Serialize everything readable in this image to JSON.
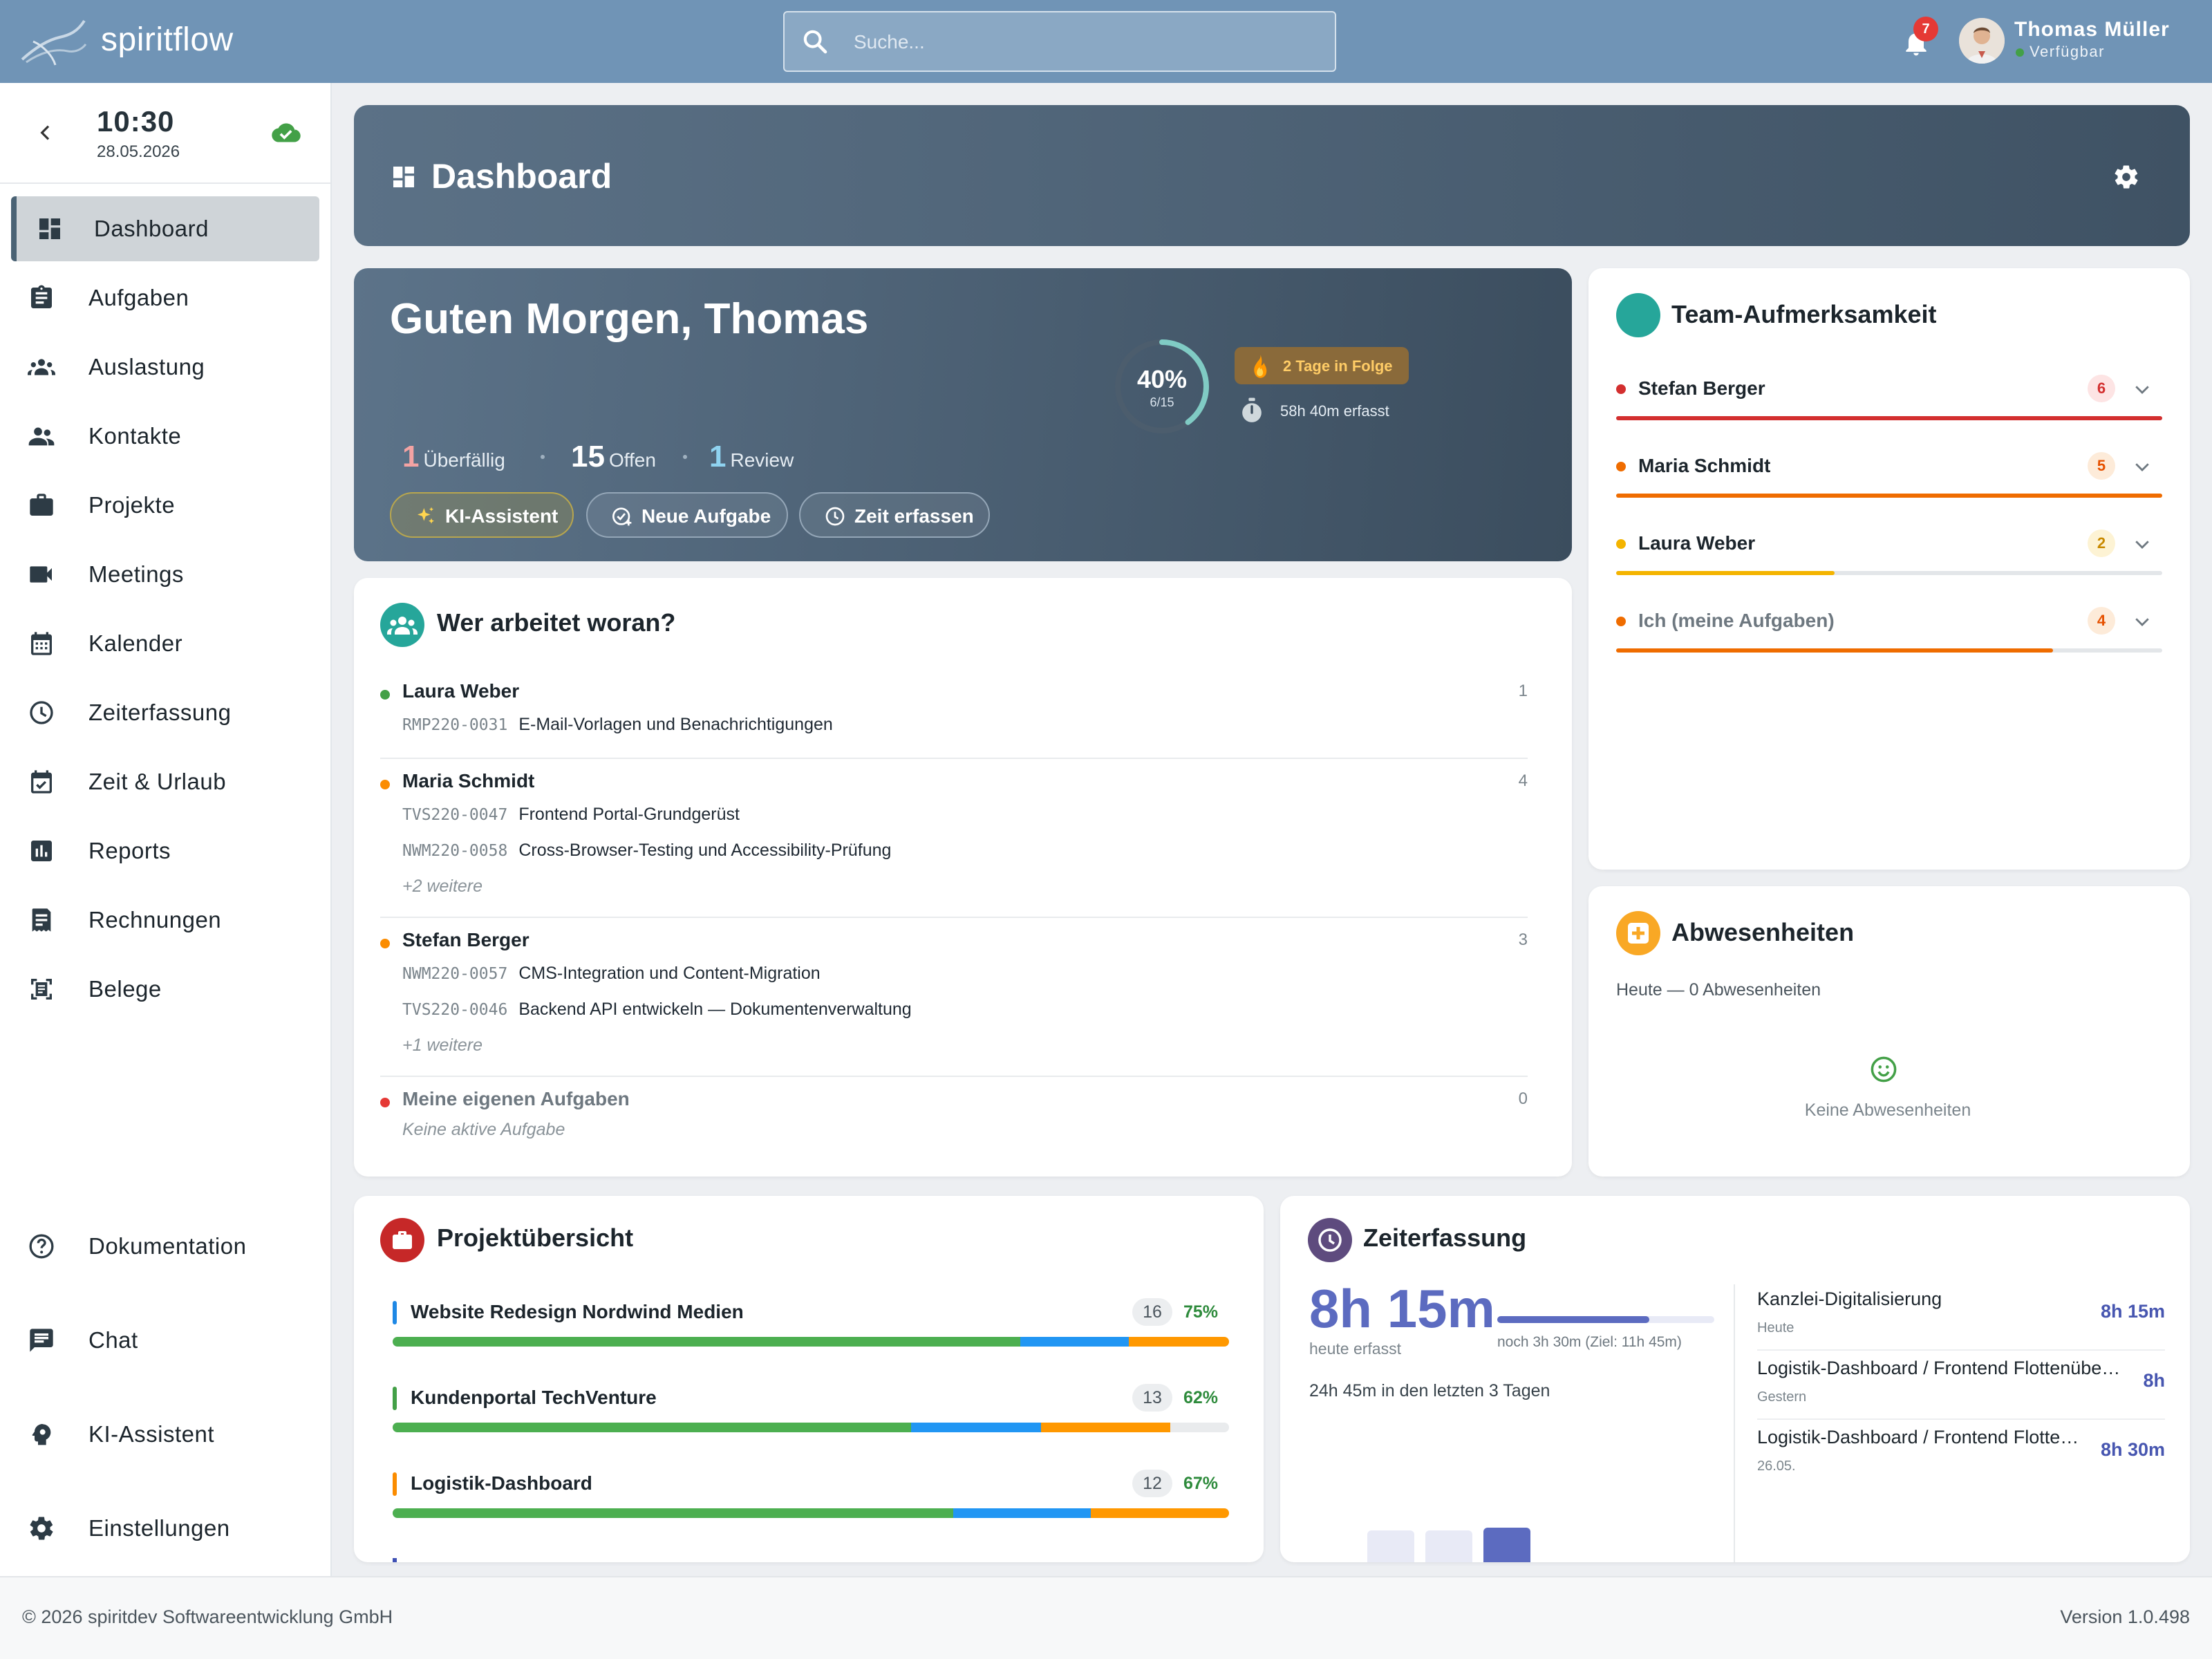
{
  "app": {
    "brand": "spiritflow",
    "search_placeholder": "Suche...",
    "notification_count": "7",
    "user": {
      "name": "Thomas Müller",
      "status": "Verfügbar"
    }
  },
  "sidebar": {
    "time": "10:30",
    "date": "28.05.2026",
    "items": [
      {
        "label": "Dashboard",
        "icon": "dashboard-icon",
        "active": true
      },
      {
        "label": "Aufgaben",
        "icon": "clipboard-icon"
      },
      {
        "label": "Auslastung",
        "icon": "group-icon"
      },
      {
        "label": "Kontakte",
        "icon": "people-icon"
      },
      {
        "label": "Projekte",
        "icon": "briefcase-icon"
      },
      {
        "label": "Meetings",
        "icon": "video-icon"
      },
      {
        "label": "Kalender",
        "icon": "calendar-icon"
      },
      {
        "label": "Zeiterfassung",
        "icon": "clock-icon"
      },
      {
        "label": "Zeit & Urlaub",
        "icon": "calendar-check-icon"
      },
      {
        "label": "Reports",
        "icon": "bar-chart-icon"
      },
      {
        "label": "Rechnungen",
        "icon": "invoice-icon"
      },
      {
        "label": "Belege",
        "icon": "receipt-icon"
      }
    ],
    "bottom_items": [
      {
        "label": "Dokumentation",
        "icon": "help-icon"
      },
      {
        "label": "Chat",
        "icon": "chat-icon"
      },
      {
        "label": "KI-Assistent",
        "icon": "ai-head-icon"
      },
      {
        "label": "Einstellungen",
        "icon": "settings-icon"
      }
    ]
  },
  "dashboard": {
    "title": "Dashboard"
  },
  "greeting": {
    "title": "Guten Morgen, Thomas",
    "progress_pct": "40%",
    "progress_fraction": "6/15",
    "progress_value": 0.4,
    "streak": "2 Tage in Folge",
    "tracked": "58h 40m erfasst",
    "stats": [
      {
        "value": "1",
        "label": "Überfällig",
        "color": "#f4a3a3"
      },
      {
        "value": "15",
        "label": "Offen",
        "color": "#ffffff"
      },
      {
        "value": "1",
        "label": "Review",
        "color": "#8fd3f0"
      }
    ],
    "buttons": {
      "ai": "KI-Assistent",
      "new_task": "Neue Aufgabe",
      "track_time": "Zeit erfassen"
    }
  },
  "who_works": {
    "title": "Wer arbeitet woran?",
    "people": [
      {
        "name": "Laura Weber",
        "count": "1",
        "color": "#43a047",
        "tasks": [
          {
            "code": "RMP220-0031",
            "title": "E-Mail-Vorlagen und Benachrichtigungen"
          }
        ],
        "more": ""
      },
      {
        "name": "Maria Schmidt",
        "count": "4",
        "color": "#fb8c00",
        "tasks": [
          {
            "code": "TVS220-0047",
            "title": "Frontend Portal-Grundgerüst"
          },
          {
            "code": "NWM220-0058",
            "title": "Cross-Browser-Testing und Accessibility-Prüfung"
          }
        ],
        "more": "+2 weitere"
      },
      {
        "name": "Stefan Berger",
        "count": "3",
        "color": "#fb8c00",
        "tasks": [
          {
            "code": "NWM220-0057",
            "title": "CMS-Integration und Content-Migration"
          },
          {
            "code": "TVS220-0046",
            "title": "Backend API entwickeln — Dokumentenverwaltung"
          }
        ],
        "more": "+1 weitere"
      },
      {
        "name": "Meine eigenen Aufgaben",
        "count": "0",
        "color": "#e53935",
        "tasks": [],
        "more": "Keine aktive Aufgabe"
      }
    ]
  },
  "team_attention": {
    "title": "Team-Aufmerksamkeit",
    "members": [
      {
        "name": "Stefan Berger",
        "count": "6",
        "color": "#d32f2f",
        "badge_bg": "#fde4e4",
        "badge_fg": "#d32f2f",
        "level": 1.0
      },
      {
        "name": "Maria Schmidt",
        "count": "5",
        "color": "#ef6c00",
        "badge_bg": "#fdebd9",
        "badge_fg": "#e65100",
        "level": 1.0
      },
      {
        "name": "Laura Weber",
        "count": "2",
        "color": "#f4b400",
        "badge_bg": "#fdf3d4",
        "badge_fg": "#c98a00",
        "level": 0.4
      },
      {
        "name": "Ich (meine Aufgaben)",
        "count": "4",
        "color": "#ef6c00",
        "badge_bg": "#fdebd9",
        "badge_fg": "#e65100",
        "level": 0.8
      }
    ]
  },
  "absences": {
    "title": "Abwesenheiten",
    "subtitle": "Heute — 0 Abwesenheiten",
    "empty": "Keine Abwesenheiten"
  },
  "projects": {
    "title": "Projektübersicht",
    "items": [
      {
        "name": "Website Redesign Nordwind Medien",
        "count": "16",
        "pct": "75%",
        "color": "#1e88e5",
        "segments": [
          0.75,
          0.13,
          0.12
        ]
      },
      {
        "name": "Kundenportal TechVenture",
        "count": "13",
        "pct": "62%",
        "color": "#43a047",
        "segments": [
          0.62,
          0.155,
          0.155
        ]
      },
      {
        "name": "Logistik-Dashboard",
        "count": "12",
        "pct": "67%",
        "color": "#fb8c00",
        "segments": [
          0.67,
          0.165,
          0.165
        ]
      }
    ]
  },
  "time_tracking": {
    "title": "Zeiterfassung",
    "today": "8h 15m",
    "today_label": "heute erfasst",
    "goal_text": "noch 3h 30m (Ziel: 11h 45m)",
    "goal_progress": 0.7,
    "last3": "24h 45m in den letzten 3 Tagen",
    "entries": [
      {
        "title": "Kanzlei-Digitalisierung",
        "date": "Heute",
        "duration": "8h 15m"
      },
      {
        "title": "Logistik-Dashboard / Frontend Flottenübersicht",
        "date": "Gestern",
        "duration": "8h"
      },
      {
        "title": "Logistik-Dashboard / Frontend Flottenübersicht",
        "date": "26.05.",
        "duration": "8h 30m"
      }
    ]
  },
  "footer": {
    "copyright": "© 2026 spiritdev Softwareentwicklung GmbH",
    "version": "Version 1.0.498"
  }
}
